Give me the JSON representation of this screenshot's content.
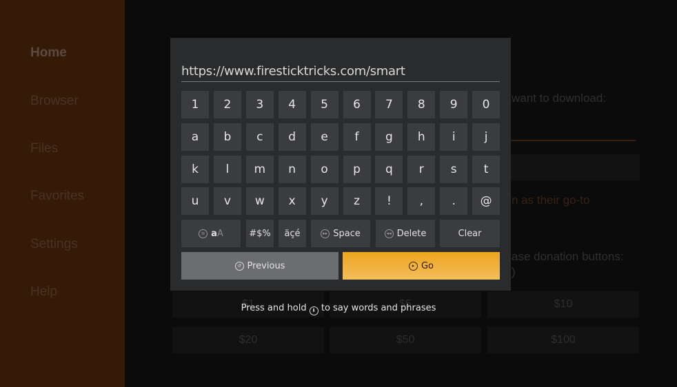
{
  "sidebar": {
    "items": [
      {
        "label": "Home",
        "active": true
      },
      {
        "label": "Browser"
      },
      {
        "label": "Files"
      },
      {
        "label": "Favorites"
      },
      {
        "label": "Settings"
      },
      {
        "label": "Help"
      }
    ]
  },
  "background": {
    "download_prompt": "want to download:",
    "orange_text": "n as their go-to",
    "donation_text": "ase donation buttons:",
    "donation_text2": ")",
    "donations": [
      "$1",
      "$5",
      "$10",
      "$20",
      "$50",
      "$100"
    ]
  },
  "keyboard": {
    "url_value": "https://www.firesticktricks.com/smart",
    "rows": [
      [
        "1",
        "2",
        "3",
        "4",
        "5",
        "6",
        "7",
        "8",
        "9",
        "0"
      ],
      [
        "a",
        "b",
        "c",
        "d",
        "e",
        "f",
        "g",
        "h",
        "i",
        "j"
      ],
      [
        "k",
        "l",
        "m",
        "n",
        "o",
        "p",
        "q",
        "r",
        "s",
        "t"
      ],
      [
        "u",
        "v",
        "w",
        "x",
        "y",
        "z",
        "!",
        ",",
        ".",
        "@"
      ]
    ],
    "case_label": "a",
    "case_label2": "A",
    "symbols_label": "#$%",
    "accents_label": "äçé",
    "space_label": "Space",
    "delete_label": "Delete",
    "clear_label": "Clear",
    "previous_label": "Previous",
    "go_label": "Go",
    "accent_color": "#eea51f"
  },
  "hint": {
    "before": "Press and hold",
    "after": "to say words and phrases",
    "icon": "microphone-icon"
  }
}
